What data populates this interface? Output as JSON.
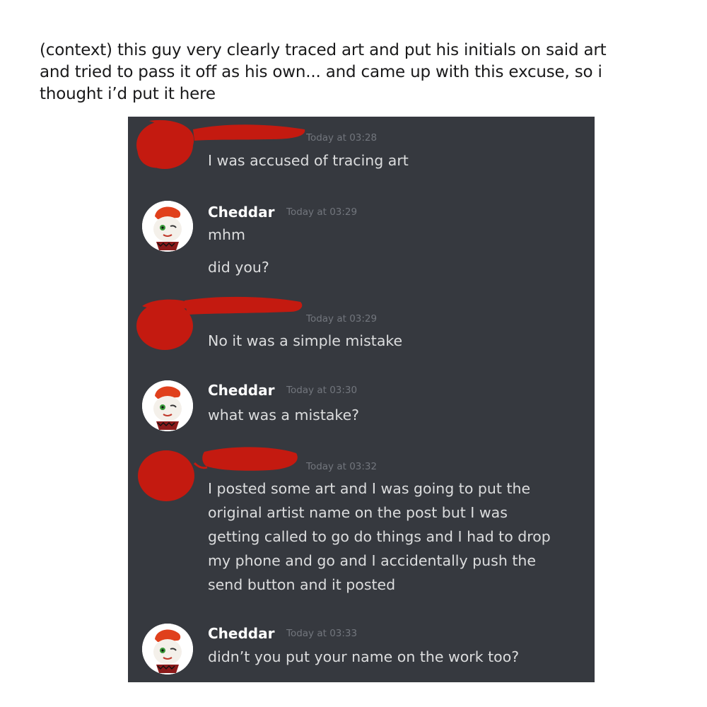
{
  "post": {
    "caption_lines": [
      "(context) this guy very clearly traced art and put his initials on said art",
      "and tried to pass it off as his own... and came up with this excuse, so i",
      "thought i’d put it here"
    ]
  },
  "colors": {
    "chat_background": "#36393f",
    "username": "#ffffff",
    "timestamp": "#72767d",
    "message_text": "#dcddde",
    "redaction_scribble": "#c41a10"
  },
  "messages": [
    {
      "author": "",
      "author_redacted": true,
      "avatar_icon": "red-scribble-redaction",
      "timestamp": "Today at 03:28",
      "lines": [
        "I was accused of tracing art"
      ]
    },
    {
      "author": "Cheddar",
      "author_redacted": false,
      "avatar_icon": "cartoon-character-avatar",
      "timestamp": "Today at 03:29",
      "lines": [
        "mhm",
        "did you?"
      ]
    },
    {
      "author": "",
      "author_redacted": true,
      "avatar_icon": "red-scribble-redaction",
      "timestamp": "Today at 03:29",
      "lines": [
        "No it was a simple mistake"
      ]
    },
    {
      "author": "Cheddar",
      "author_redacted": false,
      "avatar_icon": "cartoon-character-avatar",
      "timestamp": "Today at 03:30",
      "lines": [
        "what was a mistake?"
      ]
    },
    {
      "author": "",
      "author_redacted": true,
      "avatar_icon": "red-scribble-redaction",
      "timestamp": "Today at 03:32",
      "lines": [
        "I posted some art and I was going to put the",
        "original artist name on the post but I was",
        "getting called to go do things and I had to drop",
        "my phone and go and I accidentally push the",
        "send button and it posted"
      ]
    },
    {
      "author": "Cheddar",
      "author_redacted": false,
      "avatar_icon": "cartoon-character-avatar",
      "timestamp": "Today at 03:33",
      "lines": [
        "didn’t you put your name on the work too?"
      ]
    }
  ]
}
